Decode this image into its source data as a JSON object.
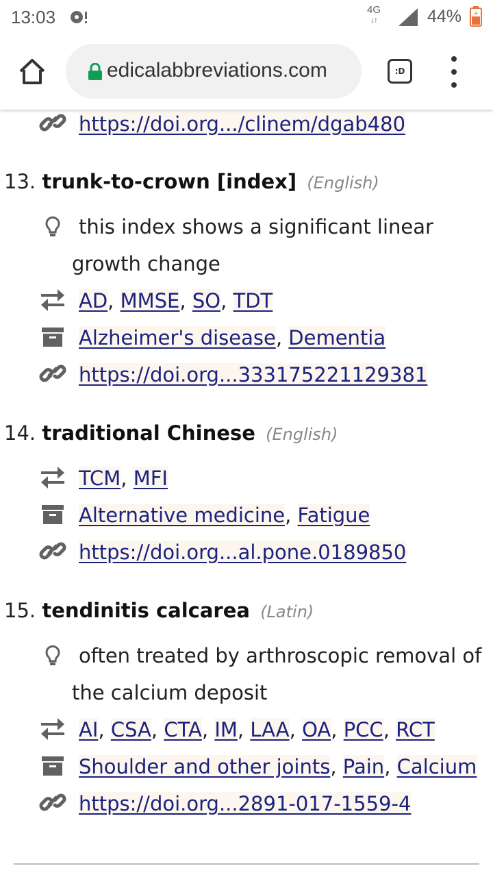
{
  "status_bar": {
    "time": "13:03",
    "network": "4G",
    "battery": "44%"
  },
  "browser": {
    "url": "edicalabbreviations.com",
    "tab_badge": ":D"
  },
  "top_link": "https://doi.org.../clinem/dgab480",
  "entries": [
    {
      "number": "13.",
      "term": "trunk-to-crown [index]",
      "language": "(English)",
      "note": "this index shows a significant linear growth change",
      "abbreviations": [
        "AD",
        "MMSE",
        "SO",
        "TDT"
      ],
      "categories": [
        "Alzheimer's disease",
        "Dementia"
      ],
      "link": "https://doi.org...333175221129381"
    },
    {
      "number": "14.",
      "term": "traditional Chinese",
      "language": "(English)",
      "abbreviations": [
        "TCM",
        "MFI"
      ],
      "categories": [
        "Alternative medicine",
        "Fatigue"
      ],
      "link": "https://doi.org...al.pone.0189850"
    },
    {
      "number": "15.",
      "term": "tendinitis calcarea",
      "language": "(Latin)",
      "note": "often treated by arthroscopic removal of the calcium deposit",
      "abbreviations": [
        "AI",
        "CSA",
        "CTA",
        "IM",
        "LAA",
        "OA",
        "PCC",
        "RCT"
      ],
      "categories": [
        "Shoulder and other joints",
        "Pain",
        "Calcium"
      ],
      "link": "https://doi.org...2891-017-1559-4"
    }
  ],
  "icons": {
    "note": "lightbulb-icon",
    "abbreviations": "swap-arrows-icon",
    "categories": "archive-box-icon",
    "link": "link-icon"
  },
  "colors": {
    "link": "#1a237e",
    "link_bg": "#fcf6ee",
    "icon": "#616161",
    "lock": "#0f9d58"
  }
}
